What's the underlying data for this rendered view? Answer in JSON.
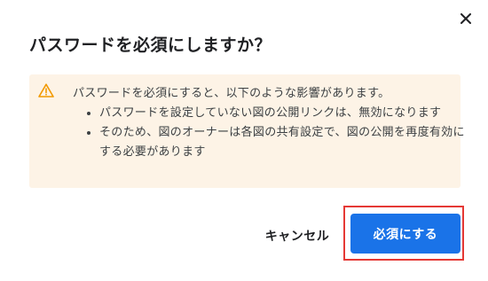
{
  "dialog": {
    "title": "パスワードを必須にしますか？",
    "close_icon": "close-icon",
    "warning": {
      "icon": "warning-triangle-icon",
      "lead": "パスワードを必須にすると、以下のような影響があります。",
      "bullets": [
        "パスワードを設定していない図の公開リンクは、無効になります",
        "そのため、図のオーナーは各図の共有設定で、図の公開を再度有効にする必要があります"
      ],
      "background_color": "#fdf3e6",
      "icon_color": "#f29900"
    },
    "buttons": {
      "cancel_label": "キャンセル",
      "confirm_label": "必須にする"
    },
    "colors": {
      "primary": "#1a73e8",
      "highlight": "#e53935"
    }
  }
}
